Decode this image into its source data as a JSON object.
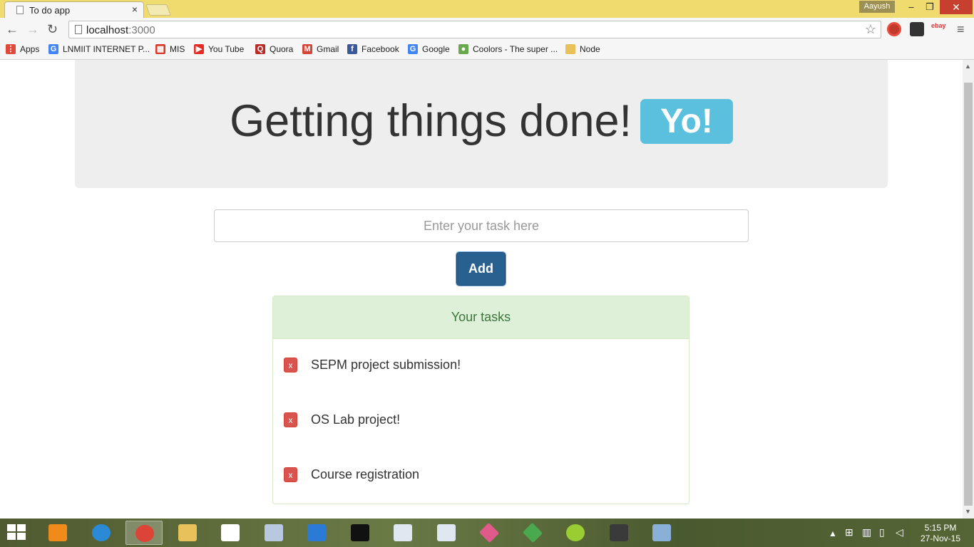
{
  "browser": {
    "tab_title": "To do app",
    "tab_close": "×",
    "user_name": "Aayush",
    "window_minimize": "–",
    "window_restore": "❐",
    "window_close": "✕",
    "url_host": "localhost",
    "url_port": ":3000",
    "back_icon": "←",
    "forward_icon": "→",
    "reload_icon": "↻",
    "star_icon": "☆",
    "menu_icon": "≡"
  },
  "bookmarks": [
    {
      "label": "Apps",
      "icon": "apps-icon",
      "color": "#e04a3a",
      "glyph": "⋮"
    },
    {
      "label": "LNMIIT INTERNET P...",
      "icon": "google-icon",
      "color": "#4285f4",
      "glyph": "G"
    },
    {
      "label": "MIS",
      "icon": "mis-icon",
      "color": "#d93a2b",
      "glyph": "▦"
    },
    {
      "label": "You Tube",
      "icon": "youtube-icon",
      "color": "#e52d27",
      "glyph": "▶"
    },
    {
      "label": "Quora",
      "icon": "quora-icon",
      "color": "#b92b27",
      "glyph": "Q"
    },
    {
      "label": "Gmail",
      "icon": "gmail-icon",
      "color": "#d44638",
      "glyph": "M"
    },
    {
      "label": "Facebook",
      "icon": "facebook-icon",
      "color": "#3b5998",
      "glyph": "f"
    },
    {
      "label": "Google",
      "icon": "google-icon",
      "color": "#4285f4",
      "glyph": "G"
    },
    {
      "label": "Coolors - The super ...",
      "icon": "coolors-icon",
      "color": "#6aa84f",
      "glyph": "●"
    },
    {
      "label": "Node",
      "icon": "folder-icon",
      "color": "#e8c15a",
      "glyph": ""
    }
  ],
  "app": {
    "heading": "Getting things done!",
    "badge": "Yo!",
    "input_placeholder": "Enter your task here",
    "add_label": "Add",
    "panel_title": "Your tasks",
    "delete_label": "x",
    "tasks": [
      "SEPM project submission!",
      "OS Lab project!",
      "Course registration"
    ]
  },
  "taskbar": {
    "time": "5:15 PM",
    "date": "27-Nov-15",
    "items": [
      {
        "name": "vlc-icon",
        "color": "#f08a1a"
      },
      {
        "name": "internet-explorer-icon",
        "color": "#2a8ad6"
      },
      {
        "name": "chrome-icon",
        "color": "#db4437"
      },
      {
        "name": "file-explorer-icon",
        "color": "#e8c15a"
      },
      {
        "name": "apps-grid-icon",
        "color": "#ffffff"
      },
      {
        "name": "keyboard-icon",
        "color": "#b8c8e0"
      },
      {
        "name": "wifi-hotspot-icon",
        "color": "#2a7ad6"
      },
      {
        "name": "command-prompt-icon",
        "color": "#111111"
      },
      {
        "name": "document-window-icon",
        "color": "#dfe8f0"
      },
      {
        "name": "document-window-icon",
        "color": "#dfe8f0"
      },
      {
        "name": "colorful-diamond-icon",
        "color": "#e05a8a"
      },
      {
        "name": "colorful-diamond-icon",
        "color": "#4aa84f"
      },
      {
        "name": "circle-app-icon",
        "color": "#9acd32"
      },
      {
        "name": "sublime-text-icon",
        "color": "#3a3a3a"
      },
      {
        "name": "paint-icon",
        "color": "#8ab0d8"
      }
    ]
  }
}
